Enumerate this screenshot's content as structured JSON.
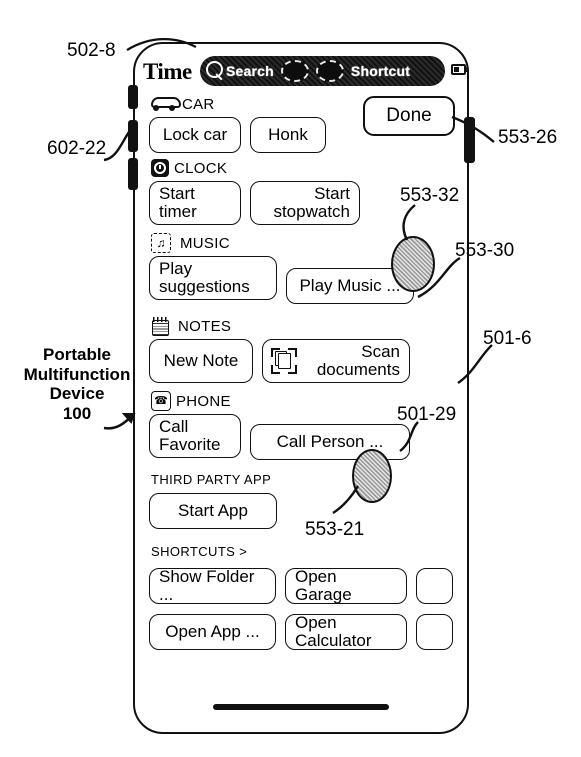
{
  "figure": {
    "device_label": "Portable\nMultifunction\nDevice\n100",
    "device_label_line1": "Portable",
    "device_label_line2": "Multifunction",
    "device_label_line3": "Device",
    "device_label_line4": "100",
    "reference_numerals": [
      {
        "id": "502-8",
        "label": "502-8"
      },
      {
        "id": "602-22",
        "label": "602-22"
      },
      {
        "id": "553-26",
        "label": "553-26"
      },
      {
        "id": "553-32",
        "label": "553-32"
      },
      {
        "id": "553-30",
        "label": "553-30"
      },
      {
        "id": "501-6",
        "label": "501-6"
      },
      {
        "id": "501-29",
        "label": "501-29"
      },
      {
        "id": "553-21",
        "label": "553-21"
      }
    ]
  },
  "status_bar": {
    "time": "Time",
    "search_placeholder": "Search",
    "shortcut_label": "Shortcut",
    "search_icon": "magnifier-icon",
    "battery_icon": "battery-icon",
    "indicator_dots": 2
  },
  "header": {
    "done_label": "Done"
  },
  "groups": [
    {
      "name": "car",
      "title": "CAR",
      "icon": "car-icon",
      "buttons": [
        {
          "label": "Lock car",
          "width": "w-lock"
        },
        {
          "label": "Honk",
          "width": "w-honk"
        }
      ]
    },
    {
      "name": "clock",
      "title": "CLOCK",
      "icon": "clock-icon",
      "buttons": [
        {
          "label_line1": "Start",
          "label_line2": "timer",
          "width": "w-timer"
        },
        {
          "label_line1": "Start",
          "label_line2": "stopwatch",
          "width": "w-stopwatch"
        }
      ]
    },
    {
      "name": "music",
      "title": "MUSIC",
      "icon": "music-note-icon",
      "buttons": [
        {
          "label_line1": "Play",
          "label_line2": "suggestions",
          "width": "w-playsugg"
        },
        {
          "label": "Play Music ...",
          "width": "w-playmusic"
        }
      ]
    },
    {
      "name": "notes",
      "title": "NOTES",
      "icon": "notepad-icon",
      "buttons": [
        {
          "label": "New Note",
          "width": "w-newnote"
        },
        {
          "label_line1": "Scan",
          "label_line2": "documents",
          "width": "w-scan",
          "icon": "scan-document-icon"
        }
      ]
    },
    {
      "name": "phone",
      "title": "PHONE",
      "icon": "phone-handset-icon",
      "buttons": [
        {
          "label_line1": "Call",
          "label_line2": "Favorite",
          "width": "w-callfav"
        },
        {
          "label": "Call Person ...",
          "width": "w-callperson"
        }
      ]
    },
    {
      "name": "third_party_app",
      "title": "THIRD PARTY APP",
      "icon": null,
      "buttons": [
        {
          "label": "Start App",
          "width": "w-startapp"
        }
      ]
    }
  ],
  "shortcuts": {
    "title": "SHORTCUTS >",
    "rows": [
      [
        "Show Folder ...",
        "Open Garage",
        ""
      ],
      [
        "Open App ...",
        "Open Calculator",
        ""
      ]
    ]
  },
  "contacts": [
    {
      "id": "553-32",
      "name": "contact-ellipse-upper"
    },
    {
      "id": "553-21",
      "name": "contact-ellipse-lower"
    }
  ]
}
